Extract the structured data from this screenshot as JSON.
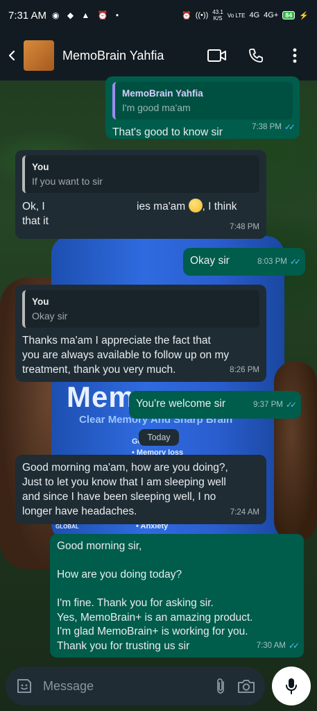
{
  "status_bar": {
    "time": "7:31 AM",
    "speed_value": "43.1",
    "speed_unit": "K/S",
    "network": "Vo LTE",
    "signal": "4G",
    "signal2": "4G+",
    "battery": "84"
  },
  "header": {
    "contact_name": "MemoBrain Yahfia",
    "icons": [
      "back-arrow-icon",
      "video-call-icon",
      "phone-icon",
      "more-vert-icon"
    ]
  },
  "messages": [
    {
      "direction": "out",
      "quote_author": "MemoBrain Yahfia",
      "quote_text": "I'm good ma'am",
      "text": "That's good to know sir",
      "time": "7:38 PM",
      "status": "read"
    },
    {
      "direction": "in",
      "quote_author": "You",
      "quote_text": "If you want to sir",
      "text_part1": "Ok, I ",
      "text_part2": "ies ma'am",
      "text_part3": ", I think",
      "text_part4": "that it",
      "time": "7:48 PM"
    },
    {
      "direction": "out",
      "text": "Okay sir",
      "time": "8:03 PM",
      "status": "read"
    },
    {
      "direction": "in",
      "quote_author": "You",
      "quote_text": "Okay sir",
      "text": "Thanks ma'am I appreciate the fact that\nyou are always available to follow up on my\ntreatment, thank you very much.",
      "time": "8:26 PM"
    },
    {
      "direction": "out",
      "text": "You're welcome sir",
      "time": "9:37 PM",
      "status": "read"
    },
    {
      "direction": "in",
      "text": "Good morning ma'am, how are you doing?,\nJust to let you know that I am sleeping well\nand since I have been sleeping well, I no\nlonger have headaches.",
      "time": "7:24 AM"
    },
    {
      "direction": "out",
      "text": "Good morning sir,\n\nHow are you doing today?\n\nI'm fine. Thank you for asking sir.\nYes, MemoBrain+ is an amazing product.\nI'm glad MemoBrain+ is working for you.\nThank you for trusting us sir",
      "time": "7:30 AM",
      "status": "read"
    }
  ],
  "date_chip": "Today",
  "wallpaper": {
    "brand": "Mem",
    "tagline": "Clear Memory And Sharp Brain",
    "feature1": "Go",
    "feature2": "• Memory loss",
    "feature3": "• Anxiety",
    "badge": "GLOBAL"
  },
  "input": {
    "placeholder": "Message",
    "icons": [
      "sticker-icon",
      "attach-icon",
      "camera-icon",
      "mic-icon"
    ]
  },
  "colors": {
    "incoming_bubble": "#1f2c34",
    "outgoing_bubble": "#005c4b",
    "read_ticks": "#53bdeb",
    "header_bg": "#121b22"
  }
}
